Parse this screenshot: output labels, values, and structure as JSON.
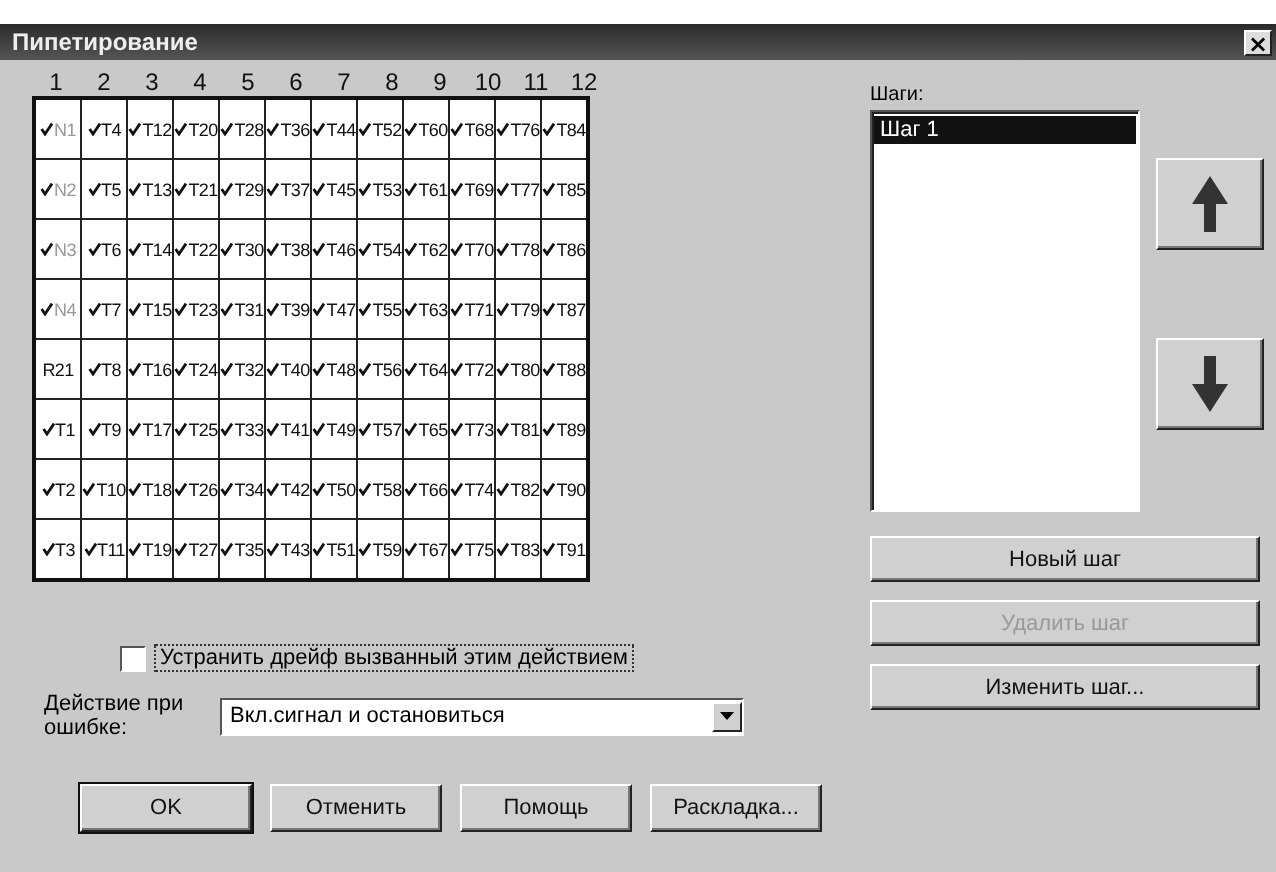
{
  "window": {
    "title": "Пипетирование",
    "close": "×"
  },
  "grid": {
    "columns": [
      "1",
      "2",
      "3",
      "4",
      "5",
      "6",
      "7",
      "8",
      "9",
      "10",
      "11",
      "12"
    ],
    "rows": [
      [
        {
          "text": "N1",
          "checked": true,
          "dimmed": true
        },
        {
          "text": "T4",
          "checked": true,
          "dimmed": false
        },
        {
          "text": "T12",
          "checked": true,
          "dimmed": false
        },
        {
          "text": "T20",
          "checked": true,
          "dimmed": false
        },
        {
          "text": "T28",
          "checked": true,
          "dimmed": false
        },
        {
          "text": "T36",
          "checked": true,
          "dimmed": false
        },
        {
          "text": "T44",
          "checked": true,
          "dimmed": false
        },
        {
          "text": "T52",
          "checked": true,
          "dimmed": false
        },
        {
          "text": "T60",
          "checked": true,
          "dimmed": false
        },
        {
          "text": "T68",
          "checked": true,
          "dimmed": false
        },
        {
          "text": "T76",
          "checked": true,
          "dimmed": false
        },
        {
          "text": "T84",
          "checked": true,
          "dimmed": false
        }
      ],
      [
        {
          "text": "N2",
          "checked": true,
          "dimmed": true
        },
        {
          "text": "T5",
          "checked": true,
          "dimmed": false
        },
        {
          "text": "T13",
          "checked": true,
          "dimmed": false
        },
        {
          "text": "T21",
          "checked": true,
          "dimmed": false
        },
        {
          "text": "T29",
          "checked": true,
          "dimmed": false
        },
        {
          "text": "T37",
          "checked": true,
          "dimmed": false
        },
        {
          "text": "T45",
          "checked": true,
          "dimmed": false
        },
        {
          "text": "T53",
          "checked": true,
          "dimmed": false
        },
        {
          "text": "T61",
          "checked": true,
          "dimmed": false
        },
        {
          "text": "T69",
          "checked": true,
          "dimmed": false
        },
        {
          "text": "T77",
          "checked": true,
          "dimmed": false
        },
        {
          "text": "T85",
          "checked": true,
          "dimmed": false
        }
      ],
      [
        {
          "text": "N3",
          "checked": true,
          "dimmed": true
        },
        {
          "text": "T6",
          "checked": true,
          "dimmed": false
        },
        {
          "text": "T14",
          "checked": true,
          "dimmed": false
        },
        {
          "text": "T22",
          "checked": true,
          "dimmed": false
        },
        {
          "text": "T30",
          "checked": true,
          "dimmed": false
        },
        {
          "text": "T38",
          "checked": true,
          "dimmed": false
        },
        {
          "text": "T46",
          "checked": true,
          "dimmed": false
        },
        {
          "text": "T54",
          "checked": true,
          "dimmed": false
        },
        {
          "text": "T62",
          "checked": true,
          "dimmed": false
        },
        {
          "text": "T70",
          "checked": true,
          "dimmed": false
        },
        {
          "text": "T78",
          "checked": true,
          "dimmed": false
        },
        {
          "text": "T86",
          "checked": true,
          "dimmed": false
        }
      ],
      [
        {
          "text": "N4",
          "checked": true,
          "dimmed": true
        },
        {
          "text": "T7",
          "checked": true,
          "dimmed": false
        },
        {
          "text": "T15",
          "checked": true,
          "dimmed": false
        },
        {
          "text": "T23",
          "checked": true,
          "dimmed": false
        },
        {
          "text": "T31",
          "checked": true,
          "dimmed": false
        },
        {
          "text": "T39",
          "checked": true,
          "dimmed": false
        },
        {
          "text": "T47",
          "checked": true,
          "dimmed": false
        },
        {
          "text": "T55",
          "checked": true,
          "dimmed": false
        },
        {
          "text": "T63",
          "checked": true,
          "dimmed": false
        },
        {
          "text": "T71",
          "checked": true,
          "dimmed": false
        },
        {
          "text": "T79",
          "checked": true,
          "dimmed": false
        },
        {
          "text": "T87",
          "checked": true,
          "dimmed": false
        }
      ],
      [
        {
          "text": "R21",
          "checked": false,
          "dimmed": false
        },
        {
          "text": "T8",
          "checked": true,
          "dimmed": false
        },
        {
          "text": "T16",
          "checked": true,
          "dimmed": false
        },
        {
          "text": "T24",
          "checked": true,
          "dimmed": false
        },
        {
          "text": "T32",
          "checked": true,
          "dimmed": false
        },
        {
          "text": "T40",
          "checked": true,
          "dimmed": false
        },
        {
          "text": "T48",
          "checked": true,
          "dimmed": false
        },
        {
          "text": "T56",
          "checked": true,
          "dimmed": false
        },
        {
          "text": "T64",
          "checked": true,
          "dimmed": false
        },
        {
          "text": "T72",
          "checked": true,
          "dimmed": false
        },
        {
          "text": "T80",
          "checked": true,
          "dimmed": false
        },
        {
          "text": "T88",
          "checked": true,
          "dimmed": false
        }
      ],
      [
        {
          "text": "T1",
          "checked": true,
          "dimmed": false
        },
        {
          "text": "T9",
          "checked": true,
          "dimmed": false
        },
        {
          "text": "T17",
          "checked": true,
          "dimmed": false
        },
        {
          "text": "T25",
          "checked": true,
          "dimmed": false
        },
        {
          "text": "T33",
          "checked": true,
          "dimmed": false
        },
        {
          "text": "T41",
          "checked": true,
          "dimmed": false
        },
        {
          "text": "T49",
          "checked": true,
          "dimmed": false
        },
        {
          "text": "T57",
          "checked": true,
          "dimmed": false
        },
        {
          "text": "T65",
          "checked": true,
          "dimmed": false
        },
        {
          "text": "T73",
          "checked": true,
          "dimmed": false
        },
        {
          "text": "T81",
          "checked": true,
          "dimmed": false
        },
        {
          "text": "T89",
          "checked": true,
          "dimmed": false
        }
      ],
      [
        {
          "text": "T2",
          "checked": true,
          "dimmed": false
        },
        {
          "text": "T10",
          "checked": true,
          "dimmed": false
        },
        {
          "text": "T18",
          "checked": true,
          "dimmed": false
        },
        {
          "text": "T26",
          "checked": true,
          "dimmed": false
        },
        {
          "text": "T34",
          "checked": true,
          "dimmed": false
        },
        {
          "text": "T42",
          "checked": true,
          "dimmed": false
        },
        {
          "text": "T50",
          "checked": true,
          "dimmed": false
        },
        {
          "text": "T58",
          "checked": true,
          "dimmed": false
        },
        {
          "text": "T66",
          "checked": true,
          "dimmed": false
        },
        {
          "text": "T74",
          "checked": true,
          "dimmed": false
        },
        {
          "text": "T82",
          "checked": true,
          "dimmed": false
        },
        {
          "text": "T90",
          "checked": true,
          "dimmed": false
        }
      ],
      [
        {
          "text": "T3",
          "checked": true,
          "dimmed": false
        },
        {
          "text": "T11",
          "checked": true,
          "dimmed": false
        },
        {
          "text": "T19",
          "checked": true,
          "dimmed": false
        },
        {
          "text": "T27",
          "checked": true,
          "dimmed": false
        },
        {
          "text": "T35",
          "checked": true,
          "dimmed": false
        },
        {
          "text": "T43",
          "checked": true,
          "dimmed": false
        },
        {
          "text": "T51",
          "checked": true,
          "dimmed": false
        },
        {
          "text": "T59",
          "checked": true,
          "dimmed": false
        },
        {
          "text": "T67",
          "checked": true,
          "dimmed": false
        },
        {
          "text": "T75",
          "checked": true,
          "dimmed": false
        },
        {
          "text": "T83",
          "checked": true,
          "dimmed": false
        },
        {
          "text": "T91",
          "checked": true,
          "dimmed": false
        }
      ]
    ]
  },
  "steps": {
    "label": "Шаги:",
    "items": [
      {
        "text": "Шаг 1",
        "selected": true
      }
    ]
  },
  "step_buttons": [
    {
      "label": "Новый шаг",
      "disabled": false
    },
    {
      "label": "Удалить шаг",
      "disabled": true
    },
    {
      "label": "Изменить шаг...",
      "disabled": false
    }
  ],
  "drift_checkbox": {
    "label": "Устранить дрейф вызванный этим действием",
    "checked": false
  },
  "error_action": {
    "label": "Действие при ошибке:",
    "value": "Вкл.сигнал и остановиться"
  },
  "buttons": [
    {
      "label": "OK",
      "default": true
    },
    {
      "label": "Отменить",
      "default": false
    },
    {
      "label": "Помощь",
      "default": false
    },
    {
      "label": "Раскладка...",
      "default": false
    }
  ]
}
